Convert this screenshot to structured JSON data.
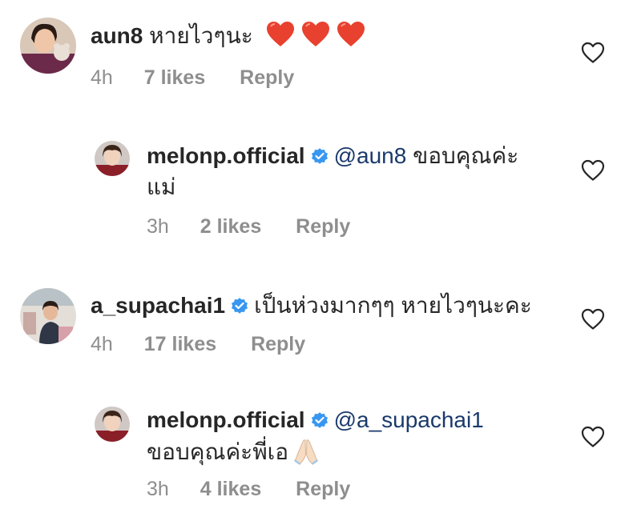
{
  "colors": {
    "text": "#262626",
    "secondary": "#8e8e8e",
    "mention": "#1a3a6b",
    "verified": "#3897f0",
    "heart_emoji": "#e8412f"
  },
  "comments": [
    {
      "username": "aun8",
      "verified": false,
      "text": "หายไวๆนะ",
      "emoji": [
        "red-heart",
        "red-heart",
        "red-heart"
      ],
      "time": "4h",
      "likes": "7 likes",
      "reply": "Reply"
    },
    {
      "username": "melonp.official",
      "verified": true,
      "mention": "@aun8",
      "text_line1": "ขอบคุณค่ะ",
      "text_line2": "แม่",
      "time": "3h",
      "likes": "2 likes",
      "reply": "Reply"
    },
    {
      "username": "a_supachai1",
      "verified": true,
      "text": "เป็นห่วงมากๆๆ หายไวๆนะคะ",
      "time": "4h",
      "likes": "17 likes",
      "reply": "Reply"
    },
    {
      "username": "melonp.official",
      "verified": true,
      "mention": "@a_supachai1",
      "text_line2": "ขอบคุณค่ะพี่เอ",
      "emoji": [
        "folded-hands"
      ],
      "time": "3h",
      "likes": "4 likes",
      "reply": "Reply"
    }
  ]
}
